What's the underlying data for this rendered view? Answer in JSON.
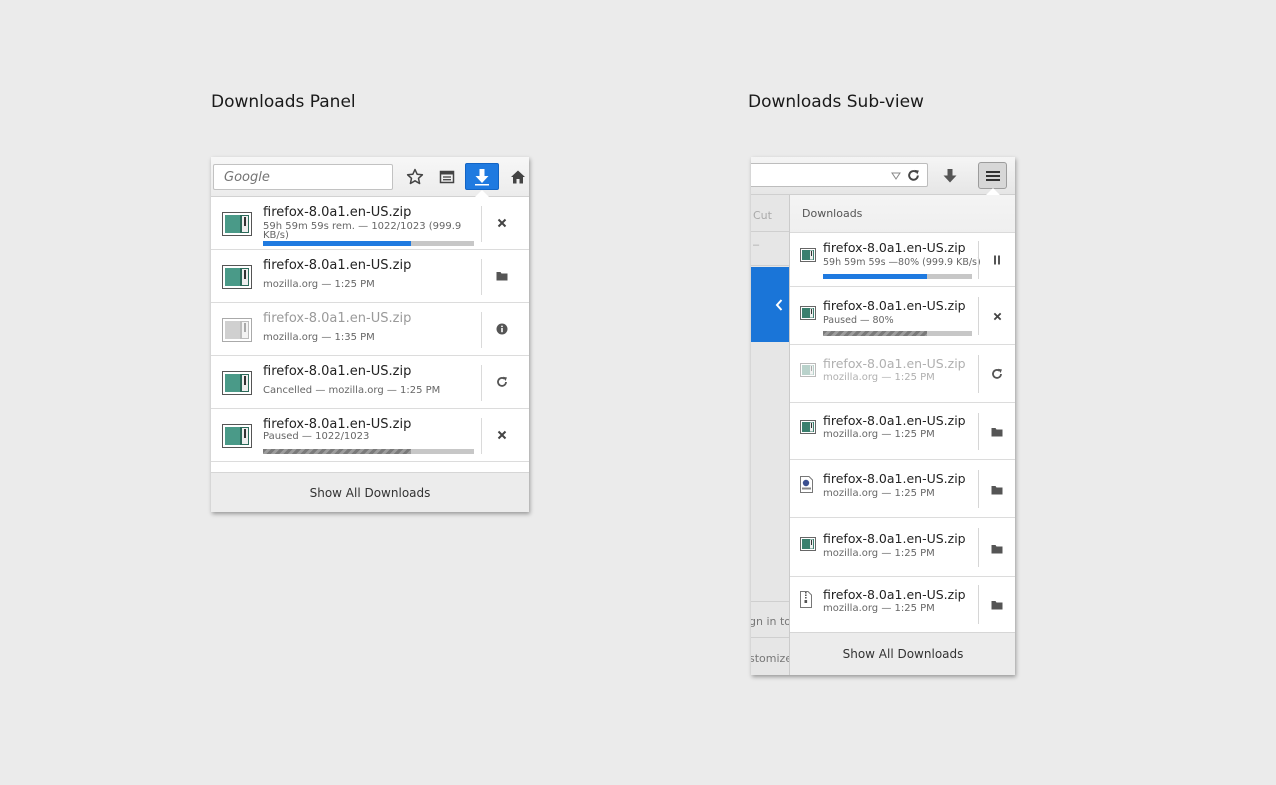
{
  "titles": {
    "panel": "Downloads Panel",
    "subview": "Downloads Sub-view"
  },
  "panel": {
    "search_placeholder": "Google",
    "toolbar_icons": [
      "star-icon",
      "reading-list-icon",
      "download-icon",
      "home-icon"
    ],
    "accent_color": "#1f7ae0",
    "items": [
      {
        "name": "firefox-8.0a1.en-US.zip",
        "status": "59h 59m 59s rem. — 1022/1023 (999.9 KB/s)",
        "progress": 0.7,
        "state": "downloading",
        "action": "close-icon"
      },
      {
        "name": "firefox-8.0a1.en-US.zip",
        "status": "mozilla.org — 1:25 PM",
        "state": "done",
        "action": "folder-icon"
      },
      {
        "name": "firefox-8.0a1.en-US.zip",
        "status": "mozilla.org — 1:35 PM",
        "state": "dim",
        "action": "info-icon"
      },
      {
        "name": "firefox-8.0a1.en-US.zip",
        "status": "Cancelled — mozilla.org — 1:25 PM",
        "state": "cancelled",
        "action": "retry-icon"
      },
      {
        "name": "firefox-8.0a1.en-US.zip",
        "status": "Paused — 1022/1023",
        "progress": 0.7,
        "state": "paused",
        "action": "close-icon"
      }
    ],
    "footer": "Show All Downloads"
  },
  "subview": {
    "header": "Downloads",
    "bg_menu": {
      "cut": "Cut",
      "dash": "–",
      "sign_in": "gn in to",
      "customize": "stomize"
    },
    "items": [
      {
        "name": "firefox-8.0a1.en-US.zip",
        "status": "59h 59m 59s —80% (999.9 KB/s)",
        "progress": 0.7,
        "state": "downloading",
        "action": "pause-icon"
      },
      {
        "name": "firefox-8.0a1.en-US.zip",
        "status": "Paused — 80%",
        "progress": 0.7,
        "state": "paused",
        "action": "close-icon"
      },
      {
        "name": "firefox-8.0a1.en-US.zip",
        "status": "mozilla.org — 1:25 PM",
        "state": "dim",
        "action": "retry-icon"
      },
      {
        "name": "firefox-8.0a1.en-US.zip",
        "status": "mozilla.org — 1:25 PM",
        "state": "done",
        "action": "folder-icon"
      },
      {
        "name": "firefox-8.0a1.en-US.zip",
        "status": "mozilla.org — 1:25 PM",
        "state": "done",
        "file_icon": "image-file-icon",
        "action": "folder-icon"
      },
      {
        "name": "firefox-8.0a1.en-US.zip",
        "status": "mozilla.org — 1:25 PM",
        "state": "done",
        "action": "folder-icon"
      },
      {
        "name": "firefox-8.0a1.en-US.zip",
        "status": "mozilla.org — 1:25 PM",
        "state": "done",
        "file_icon": "zip-file-icon",
        "action": "folder-icon"
      }
    ],
    "footer": "Show All Downloads"
  }
}
